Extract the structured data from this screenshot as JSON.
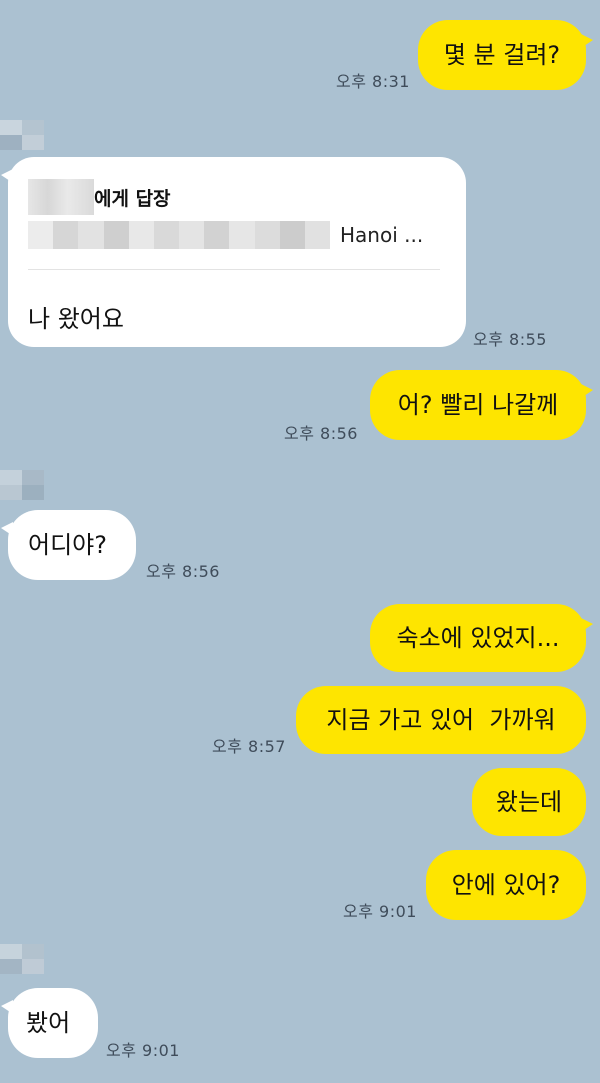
{
  "messages": [
    {
      "id": "m1",
      "side": "mine",
      "text": "몇 분 걸려?",
      "time": "오후 8:31"
    },
    {
      "id": "m2",
      "side": "theirs",
      "reply": {
        "header_suffix": "에게 답장",
        "quote_text": "Hanoi ..."
      },
      "text": "나 왔어요",
      "time": "오후 8:55"
    },
    {
      "id": "m3",
      "side": "mine",
      "text": "어? 빨리 나갈께",
      "time": "오후 8:56"
    },
    {
      "id": "m4",
      "side": "theirs",
      "text": "어디야?",
      "time": "오후 8:56"
    },
    {
      "id": "m5",
      "side": "mine",
      "text": "숙소에 있었지...",
      "time": ""
    },
    {
      "id": "m6",
      "side": "mine",
      "text": "지금 가고 있어  가까워",
      "time": "오후 8:57"
    },
    {
      "id": "m7",
      "side": "mine",
      "text": "왔는데",
      "time": ""
    },
    {
      "id": "m8",
      "side": "mine",
      "text": "안에 있어?",
      "time": "오후 9:01"
    },
    {
      "id": "m9",
      "side": "theirs",
      "text": "봤어",
      "time": "오후 9:01"
    }
  ],
  "colors": {
    "background": "#abc1d1",
    "my_bubble": "#fee500",
    "their_bubble": "#ffffff"
  }
}
